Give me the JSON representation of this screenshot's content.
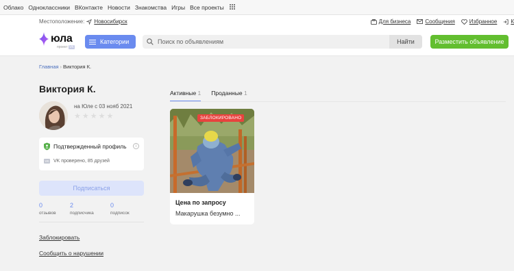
{
  "portal": {
    "links": [
      "Облако",
      "Одноклассники",
      "ВКонтакте",
      "Новости",
      "Знакомства",
      "Игры",
      "Все проекты"
    ]
  },
  "header": {
    "location_label": "Местоположение:",
    "city": "Новосибирск",
    "links": {
      "business": "Для бизнеса",
      "messages": "Сообщения",
      "favorites": "Избранное",
      "more": "К"
    },
    "logo_text": "юла",
    "logo_sub": "проект",
    "logo_sub_badge": "VK",
    "categories_label": "Категории",
    "search_placeholder": "Поиск по объявлениям",
    "search_button": "Найти",
    "post_button": "Разместить объявление"
  },
  "breadcrumb": {
    "home": "Главная",
    "separator": "›",
    "current": "Виктория К."
  },
  "profile": {
    "name": "Виктория К.",
    "since": "на Юле с 03 нояб 2021",
    "rating_stars": 0,
    "verified_label": "Подтвержденный профиль",
    "vk_badge": "VK",
    "vk_text": "VK проверено, 85 друзей",
    "subscribe_label": "Подписаться",
    "stats": [
      {
        "num": "0",
        "label": "отзывов"
      },
      {
        "num": "2",
        "label": "подписчика"
      },
      {
        "num": "0",
        "label": "подписок"
      }
    ],
    "block_link": "Заблокировать",
    "report_link": "Сообщить о нарушении"
  },
  "tabs": [
    {
      "label": "Активные",
      "count": "1"
    },
    {
      "label": "Проданные",
      "count": "1"
    }
  ],
  "listing": {
    "badge": "ЗАБЛОКИРОВАНО",
    "price": "Цена по запросу",
    "title": "Макарушка безумно ..."
  },
  "colors": {
    "accent": "#6a8bef",
    "green": "#62be2f",
    "blocked": "#e8433e",
    "verified": "#56b04a"
  }
}
